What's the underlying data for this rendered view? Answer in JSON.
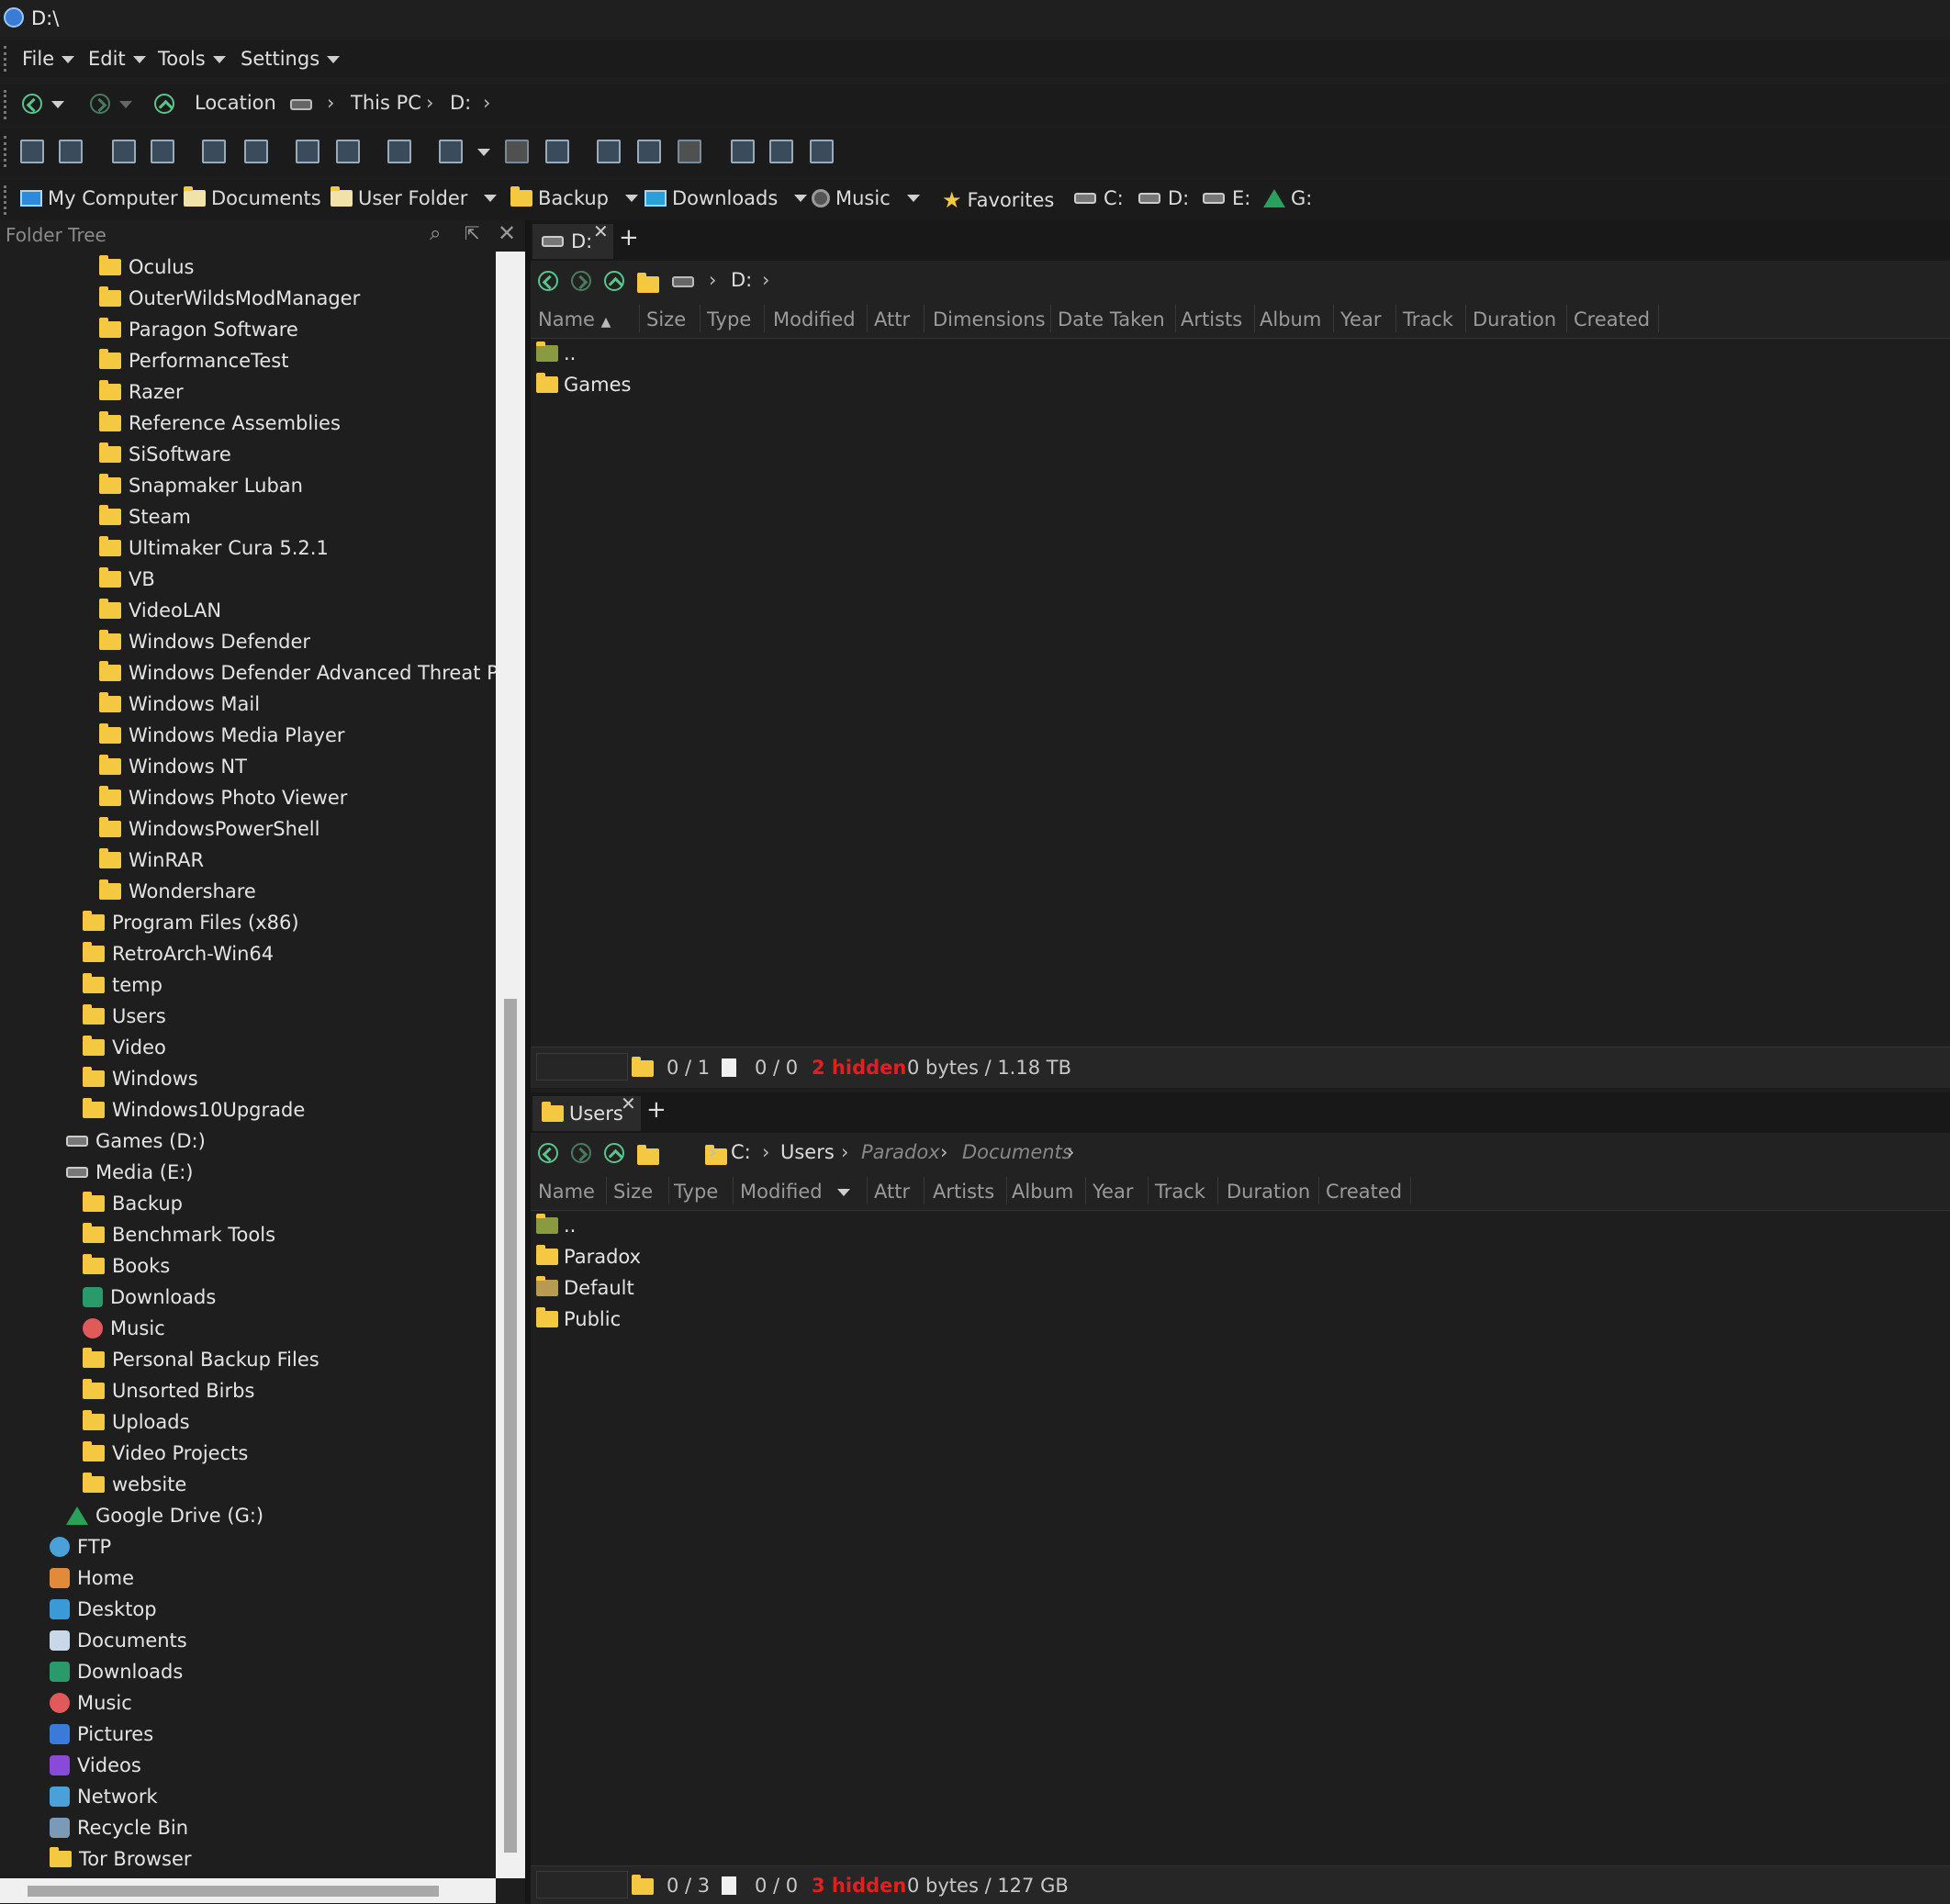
{
  "window": {
    "title": "D:\\"
  },
  "menu": [
    "File",
    "Edit",
    "Tools",
    "Settings"
  ],
  "location": {
    "label": "Location",
    "crumbs": [
      "This PC",
      "D:"
    ]
  },
  "favorites": [
    {
      "label": "My Computer",
      "icon": "computer-icon"
    },
    {
      "label": "Documents",
      "icon": "documents-icon"
    },
    {
      "label": "User Folder",
      "icon": "folder-icon",
      "dropdown": true
    },
    {
      "label": "Backup",
      "icon": "folder-icon",
      "dropdown": true
    },
    {
      "label": "Downloads",
      "icon": "downloads-icon",
      "dropdown": true
    },
    {
      "label": "Music",
      "icon": "music-icon",
      "dropdown": true
    },
    {
      "label": "Favorites",
      "icon": "star-icon"
    },
    {
      "label": "C:",
      "icon": "drive-icon"
    },
    {
      "label": "D:",
      "icon": "drive-icon"
    },
    {
      "label": "E:",
      "icon": "drive-icon"
    },
    {
      "label": "G:",
      "icon": "google-drive-icon"
    }
  ],
  "tree": {
    "title": "Folder Tree",
    "items": [
      {
        "label": "Oculus",
        "level": 3,
        "icon": "folder"
      },
      {
        "label": "OuterWildsModManager",
        "level": 3,
        "icon": "folder"
      },
      {
        "label": "Paragon Software",
        "level": 3,
        "icon": "folder"
      },
      {
        "label": "PerformanceTest",
        "level": 3,
        "icon": "folder"
      },
      {
        "label": "Razer",
        "level": 3,
        "icon": "folder"
      },
      {
        "label": "Reference Assemblies",
        "level": 3,
        "icon": "folder"
      },
      {
        "label": "SiSoftware",
        "level": 3,
        "icon": "folder"
      },
      {
        "label": "Snapmaker Luban",
        "level": 3,
        "icon": "folder"
      },
      {
        "label": "Steam",
        "level": 3,
        "icon": "folder"
      },
      {
        "label": "Ultimaker Cura 5.2.1",
        "level": 3,
        "icon": "folder"
      },
      {
        "label": "VB",
        "level": 3,
        "icon": "folder"
      },
      {
        "label": "VideoLAN",
        "level": 3,
        "icon": "folder"
      },
      {
        "label": "Windows Defender",
        "level": 3,
        "icon": "folder"
      },
      {
        "label": "Windows Defender Advanced Threat Protection",
        "level": 3,
        "icon": "folder"
      },
      {
        "label": "Windows Mail",
        "level": 3,
        "icon": "folder"
      },
      {
        "label": "Windows Media Player",
        "level": 3,
        "icon": "folder"
      },
      {
        "label": "Windows NT",
        "level": 3,
        "icon": "folder"
      },
      {
        "label": "Windows Photo Viewer",
        "level": 3,
        "icon": "folder"
      },
      {
        "label": "WindowsPowerShell",
        "level": 3,
        "icon": "folder"
      },
      {
        "label": "WinRAR",
        "level": 3,
        "icon": "folder"
      },
      {
        "label": "Wondershare",
        "level": 3,
        "icon": "folder"
      },
      {
        "label": "Program Files (x86)",
        "level": 2,
        "icon": "folder"
      },
      {
        "label": "RetroArch-Win64",
        "level": 2,
        "icon": "folder"
      },
      {
        "label": "temp",
        "level": 2,
        "icon": "folder"
      },
      {
        "label": "Users",
        "level": 2,
        "icon": "folder"
      },
      {
        "label": "Video",
        "level": 2,
        "icon": "folder"
      },
      {
        "label": "Windows",
        "level": 2,
        "icon": "folder"
      },
      {
        "label": "Windows10Upgrade",
        "level": 2,
        "icon": "folder"
      },
      {
        "label": "Games (D:)",
        "level": 1,
        "icon": "drive"
      },
      {
        "label": "Media (E:)",
        "level": 1,
        "icon": "drive"
      },
      {
        "label": "Backup",
        "level": 2,
        "icon": "folder"
      },
      {
        "label": "Benchmark Tools",
        "level": 2,
        "icon": "folder"
      },
      {
        "label": "Books",
        "level": 2,
        "icon": "folder"
      },
      {
        "label": "Downloads",
        "level": 2,
        "icon": "downloads"
      },
      {
        "label": "Music",
        "level": 2,
        "icon": "music"
      },
      {
        "label": "Personal Backup Files",
        "level": 2,
        "icon": "folder"
      },
      {
        "label": "Unsorted Birbs",
        "level": 2,
        "icon": "folder"
      },
      {
        "label": "Uploads",
        "level": 2,
        "icon": "folder"
      },
      {
        "label": "Video Projects",
        "level": 2,
        "icon": "folder"
      },
      {
        "label": "website",
        "level": 2,
        "icon": "folder"
      },
      {
        "label": "Google Drive (G:)",
        "level": 1,
        "icon": "gdrive"
      },
      {
        "label": "FTP",
        "level": 0,
        "icon": "ftp"
      },
      {
        "label": "Home",
        "level": 0,
        "icon": "home"
      },
      {
        "label": "Desktop",
        "level": 0,
        "icon": "desktop"
      },
      {
        "label": "Documents",
        "level": 0,
        "icon": "documents"
      },
      {
        "label": "Downloads",
        "level": 0,
        "icon": "downloads"
      },
      {
        "label": "Music",
        "level": 0,
        "icon": "music"
      },
      {
        "label": "Pictures",
        "level": 0,
        "icon": "pictures"
      },
      {
        "label": "Videos",
        "level": 0,
        "icon": "videos"
      },
      {
        "label": "Network",
        "level": 0,
        "icon": "network"
      },
      {
        "label": "Recycle Bin",
        "level": 0,
        "icon": "recycle"
      },
      {
        "label": "Tor Browser",
        "level": 0,
        "icon": "folder"
      }
    ]
  },
  "pane_top": {
    "tab": "D:",
    "crumbs": [
      "D:"
    ],
    "columns": [
      "Name",
      "Size",
      "Type",
      "Modified",
      "Attr",
      "Dimensions",
      "Date Taken",
      "Artists",
      "Album",
      "Year",
      "Track",
      "Duration",
      "Created"
    ],
    "items": [
      "..",
      "Games"
    ],
    "status": {
      "folders": "0 / 1",
      "files": "0 / 0",
      "hidden": "2 hidden",
      "bytes": "0 bytes / 1.18 TB"
    }
  },
  "pane_bottom": {
    "tab": "Users",
    "crumbs": [
      "C:",
      "Users",
      "Paradox",
      "Documents"
    ],
    "columns": [
      "Name",
      "Size",
      "Type",
      "Modified",
      "Attr",
      "Artists",
      "Album",
      "Year",
      "Track",
      "Duration",
      "Created"
    ],
    "items": [
      "..",
      "Paradox",
      "Default",
      "Public"
    ],
    "status": {
      "folders": "0 / 3",
      "files": "0 / 0",
      "hidden": "3 hidden",
      "bytes": "0 bytes / 127 GB"
    }
  },
  "colors": {
    "accent_green": "#5cc48a",
    "folder_yellow": "#f5c842",
    "hidden_red": "#e02020"
  }
}
